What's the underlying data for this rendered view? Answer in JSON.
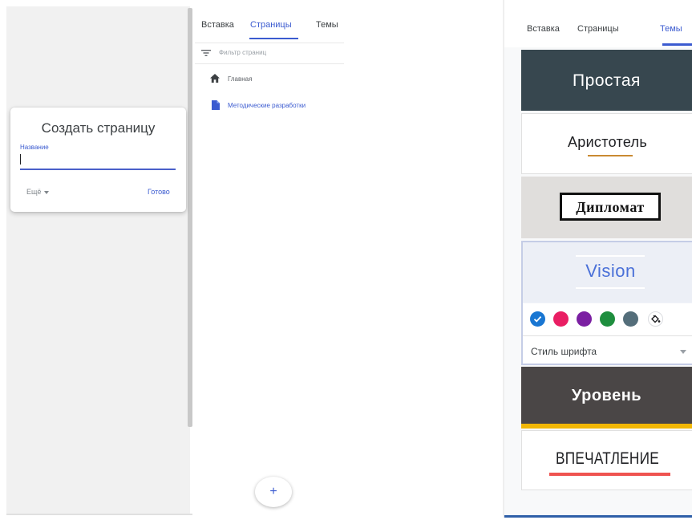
{
  "dialog": {
    "title": "Создать страницу",
    "name_label": "Название",
    "name_value": "",
    "more_label": "Ещё",
    "done_label": "Готово"
  },
  "middle_panel": {
    "tabs": [
      {
        "label": "Вставка",
        "active": false
      },
      {
        "label": "Страницы",
        "active": true
      },
      {
        "label": "Темы",
        "active": false
      }
    ],
    "filter_placeholder": "Фильтр страниц",
    "pages": [
      {
        "label": "Главная",
        "icon": "home-icon"
      },
      {
        "label": "Методические разработки",
        "icon": "page-icon"
      }
    ],
    "add_button": "+"
  },
  "right_panel": {
    "tabs": [
      {
        "label": "Вставка",
        "active": false
      },
      {
        "label": "Страницы",
        "active": false
      },
      {
        "label": "Темы",
        "active": true
      }
    ],
    "themes": [
      {
        "name": "Простая"
      },
      {
        "name": "Аристотель"
      },
      {
        "name": "Дипломат"
      },
      {
        "name": "Vision",
        "selected": true
      },
      {
        "name": "Уровень"
      },
      {
        "name": "ВПЕЧАТЛЕНИЕ"
      }
    ],
    "color_swatches": [
      "#1976d2",
      "#e91e63",
      "#7b1fa2",
      "#1e8e3e",
      "#546e7a"
    ],
    "selected_swatch": "#1976d2",
    "font_style_label": "Стиль шрифта"
  },
  "colors": {
    "accent": "#3b5bd0"
  }
}
